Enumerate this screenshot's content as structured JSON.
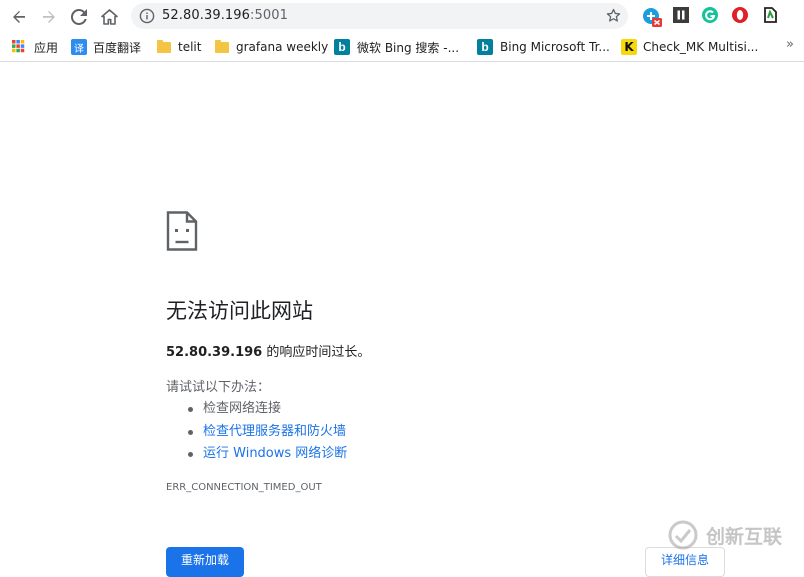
{
  "browser": {
    "url_host": "52.80.39.196",
    "url_port": ":5001"
  },
  "bookmarks": {
    "items": [
      {
        "label": "应用",
        "icon": "apps-grid-icon"
      },
      {
        "label": "百度翻译",
        "icon": "baidu-translate-icon"
      },
      {
        "label": "telit",
        "icon": "folder-icon"
      },
      {
        "label": "grafana weekly",
        "icon": "folder-icon"
      },
      {
        "label": "微软 Bing 搜索 -...",
        "icon": "bing-icon"
      },
      {
        "label": "Bing Microsoft Tr...",
        "icon": "bing-icon"
      },
      {
        "label": "Check_MK Multisi...",
        "icon": "checkmk-icon"
      }
    ],
    "overflow": "»"
  },
  "error": {
    "heading": "无法访问此网站",
    "host": "52.80.39.196",
    "summary_suffix": " 的响应时间过长。",
    "try_title": "请试试以下办法：",
    "suggestions": [
      "检查网络连接",
      "检查代理服务器和防火墙",
      "运行 Windows 网络诊断"
    ],
    "code": "ERR_CONNECTION_TIMED_OUT",
    "reload_label": "重新加载",
    "details_label": "详细信息"
  },
  "watermark": {
    "text": "创新互联"
  },
  "colors": {
    "link": "#1a73e8",
    "button": "#1a73e8",
    "text": "#202124",
    "muted": "#5f6368"
  }
}
